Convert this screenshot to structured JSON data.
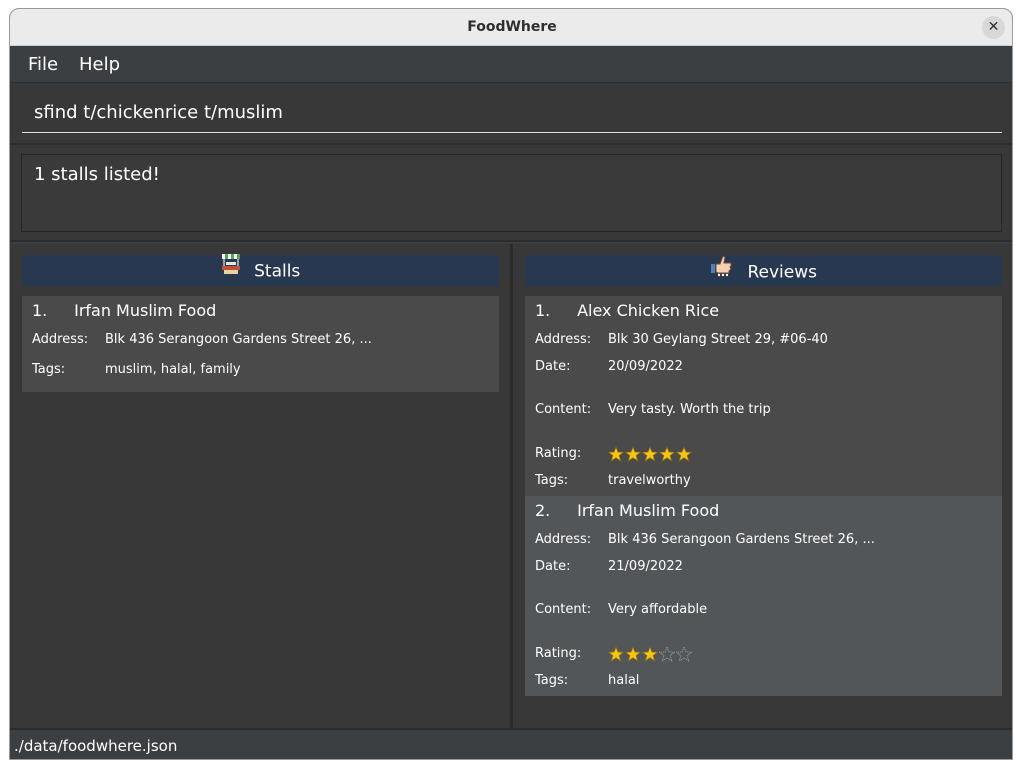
{
  "window": {
    "title": "FoodWhere",
    "close_glyph": "✕"
  },
  "menu": {
    "file": "File",
    "help": "Help"
  },
  "command": {
    "value": "sfind t/chickenrice t/muslim"
  },
  "result": {
    "message": "1 stalls listed!"
  },
  "stalls": {
    "header": "Stalls",
    "header_icon": "food-stall-icon",
    "items": [
      {
        "index": "1.",
        "name": "Irfan Muslim Food",
        "address_label": "Address:",
        "address": "Blk 436 Serangoon Gardens Street 26, ...",
        "tags_label": "Tags:",
        "tags": "muslim, halal, family"
      }
    ]
  },
  "reviews": {
    "header": "Reviews",
    "header_icon": "thumbs-up-icon",
    "items": [
      {
        "index": "1.",
        "name": "Alex Chicken Rice",
        "address_label": "Address:",
        "address": "Blk 30 Geylang Street 29, #06-40",
        "date_label": "Date:",
        "date": "20/09/2022",
        "content_label": "Content:",
        "content": "Very tasty. Worth the trip",
        "rating_label": "Rating:",
        "rating": 5,
        "rating_max": 5,
        "tags_label": "Tags:",
        "tags": "travelworthy"
      },
      {
        "index": "2.",
        "name": "Irfan Muslim Food",
        "address_label": "Address:",
        "address": "Blk 436 Serangoon Gardens Street 26, ...",
        "date_label": "Date:",
        "date": "21/09/2022",
        "content_label": "Content:",
        "content": "Very affordable",
        "rating_label": "Rating:",
        "rating": 3,
        "rating_max": 5,
        "tags_label": "Tags:",
        "tags": "halal"
      }
    ]
  },
  "status": {
    "path": "./data/foodwhere.json"
  },
  "colors": {
    "panel_header": "#283850",
    "star_filled": "#f5c518",
    "card_odd": "#4a4a4a",
    "card_even": "#525659"
  }
}
